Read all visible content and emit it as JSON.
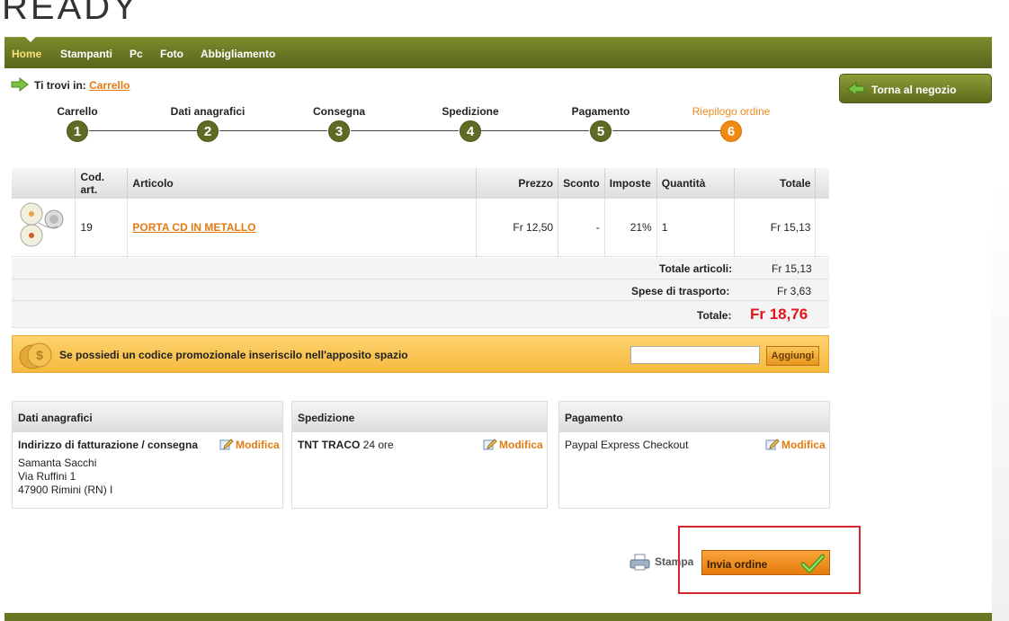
{
  "logo": {
    "text": "READY"
  },
  "nav": {
    "items": [
      "Home",
      "Stampanti",
      "Pc",
      "Foto",
      "Abbigliamento"
    ]
  },
  "breadcrumb": {
    "prefix": "Ti trovi in:",
    "current": "Carrello"
  },
  "back_button": {
    "label": "Torna al negozio"
  },
  "steps": [
    {
      "label": "Carrello",
      "num": "1"
    },
    {
      "label": "Dati anagrafici",
      "num": "2"
    },
    {
      "label": "Consegna",
      "num": "3"
    },
    {
      "label": "Spedizione",
      "num": "4"
    },
    {
      "label": "Pagamento",
      "num": "5"
    },
    {
      "label": "Riepilogo ordine",
      "num": "6"
    }
  ],
  "table": {
    "headers": [
      "",
      "Cod. art.",
      "Articolo",
      "Prezzo",
      "Sconto",
      "Imposte",
      "Quantità",
      "Totale"
    ],
    "rows": [
      {
        "code": "19",
        "article": "PORTA CD IN METALLO",
        "price": "Fr 12,50",
        "discount": "-",
        "tax": "21%",
        "qty": "1",
        "total": "Fr 15,13"
      }
    ]
  },
  "totals": {
    "items_label": "Totale articoli:",
    "items_value": "Fr 15,13",
    "shipping_label": "Spese di trasporto:",
    "shipping_value": "Fr 3,63",
    "total_label": "Totale:",
    "total_value": "Fr 18,76"
  },
  "promo": {
    "text": "Se possiedi un codice promozionale inseriscilo nell'apposito spazio",
    "input_value": "",
    "button": "Aggiungi"
  },
  "boxes": {
    "anagrafici": {
      "title": "Dati anagrafici",
      "subtitle": "Indirizzo di fatturazione / consegna",
      "modify": "Modifica",
      "name": "Samanta Sacchi",
      "street": "Via Ruffini 1",
      "city": "47900 Rimini (RN) I"
    },
    "spedizione": {
      "title": "Spedizione",
      "carrier": "TNT TRACO",
      "time": "24 ore",
      "modify": "Modifica"
    },
    "pagamento": {
      "title": "Pagamento",
      "method": "Paypal Express Checkout",
      "modify": "Modifica"
    }
  },
  "actions": {
    "print": "Stampa",
    "send": "Invia ordine"
  },
  "colors": {
    "nav": "#6b7a25",
    "accent": "#e27b12",
    "total_red": "#e0141b",
    "highlight": "#d8262d"
  }
}
